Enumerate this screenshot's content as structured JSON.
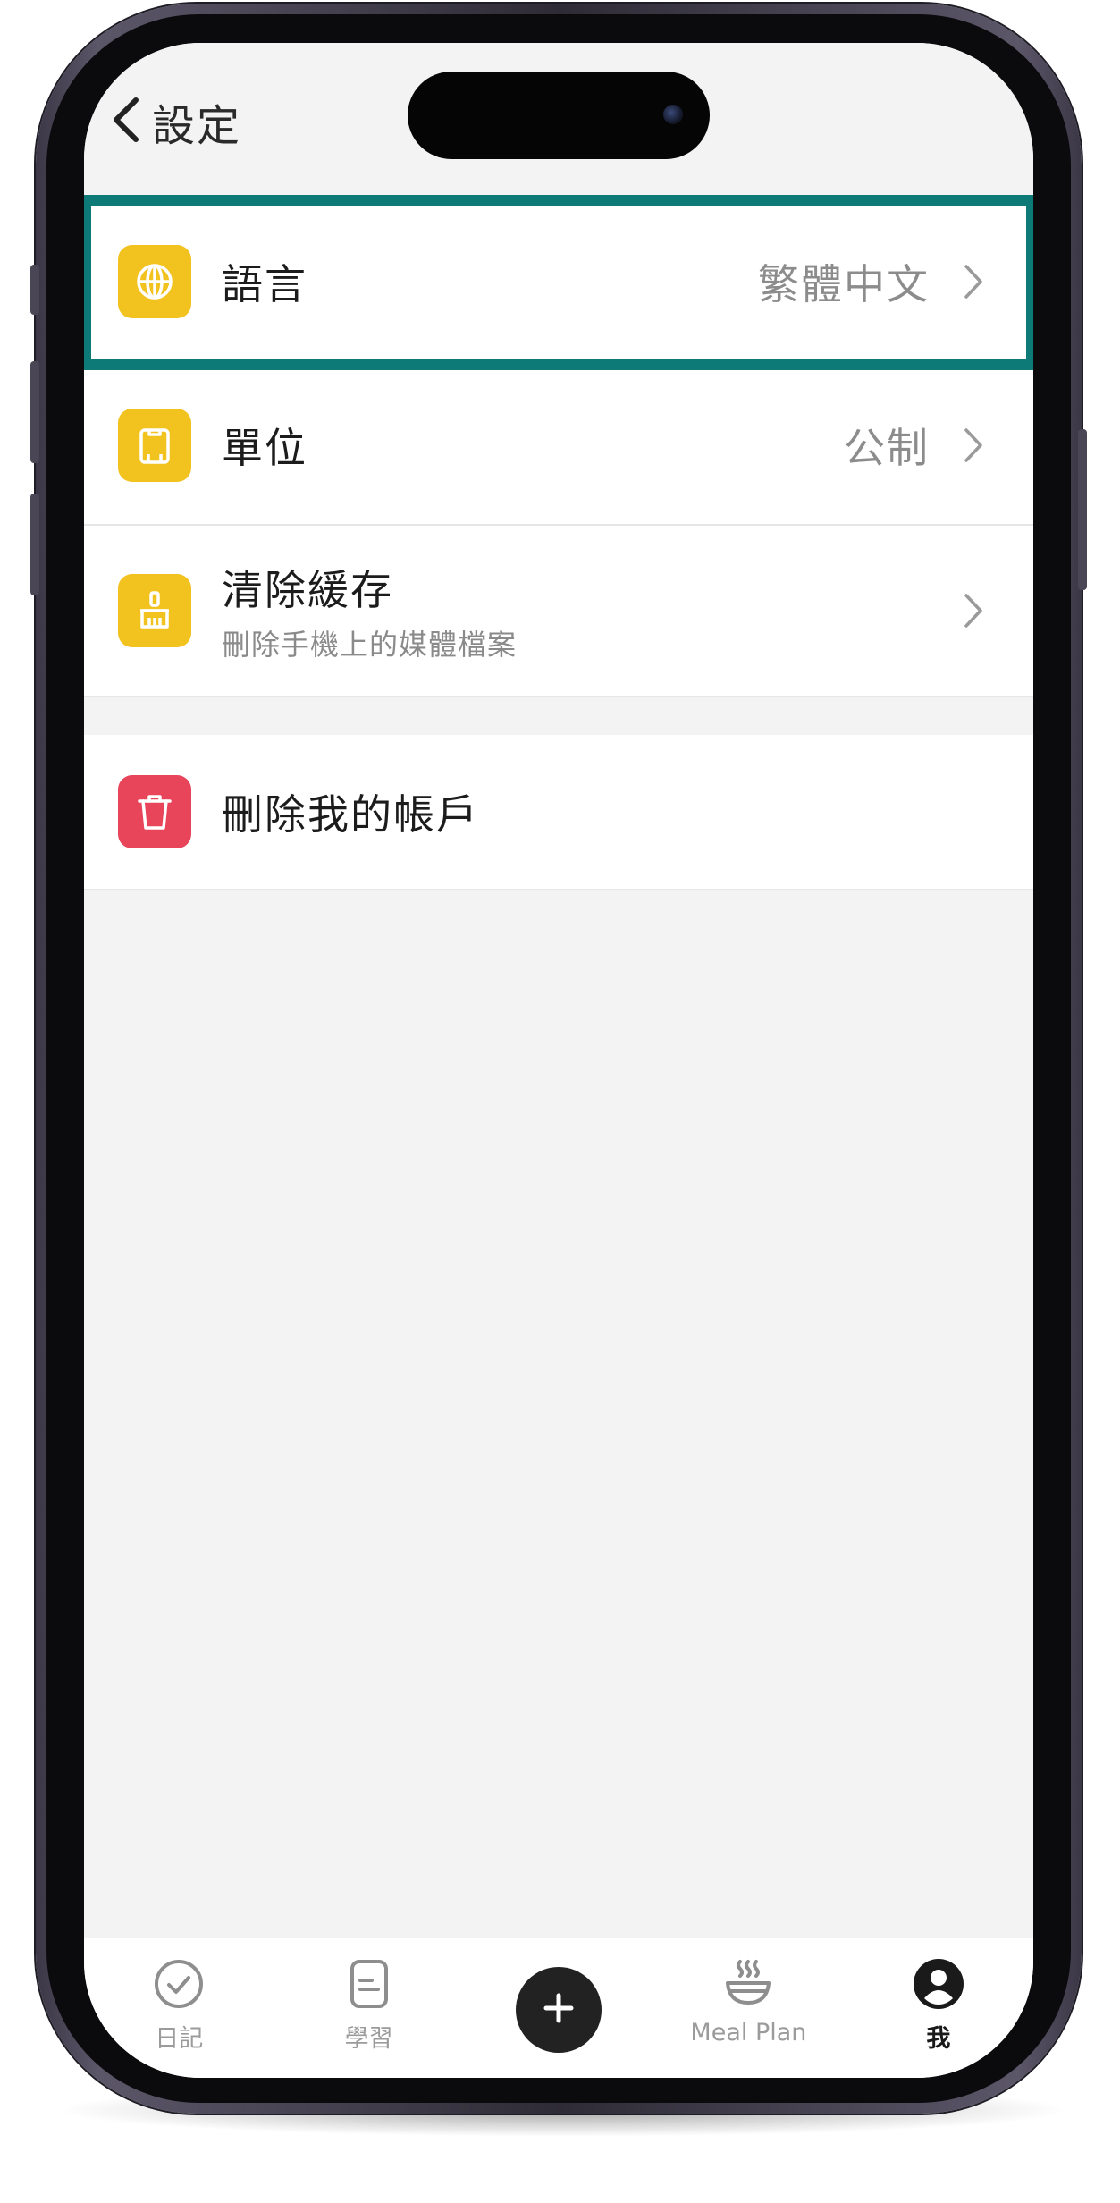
{
  "header": {
    "back_icon": "chevron-left-icon",
    "title": "設定"
  },
  "settings": {
    "language": {
      "icon": "globe-icon",
      "label": "語言",
      "value": "繁體中文",
      "highlighted": true
    },
    "units": {
      "icon": "clipboard-icon",
      "label": "單位",
      "value": "公制"
    },
    "cache": {
      "icon": "broom-icon",
      "label": "清除緩存",
      "description": "刪除手機上的媒體檔案"
    },
    "delete_account": {
      "icon": "trash-icon",
      "label": "刪除我的帳戶"
    }
  },
  "tab_bar": {
    "items": [
      {
        "label": "日記",
        "icon": "check-circle-icon"
      },
      {
        "label": "學習",
        "icon": "document-icon"
      },
      {
        "label": "",
        "icon": "plus-icon"
      },
      {
        "label": "Meal Plan",
        "icon": "bowl-icon"
      },
      {
        "label": "我",
        "icon": "user-icon",
        "active": true
      }
    ]
  },
  "colors": {
    "accent_yellow": "#f2c21f",
    "danger_red": "#e8445a",
    "highlight_teal": "#0d7a77",
    "background": "#f3f3f3"
  }
}
